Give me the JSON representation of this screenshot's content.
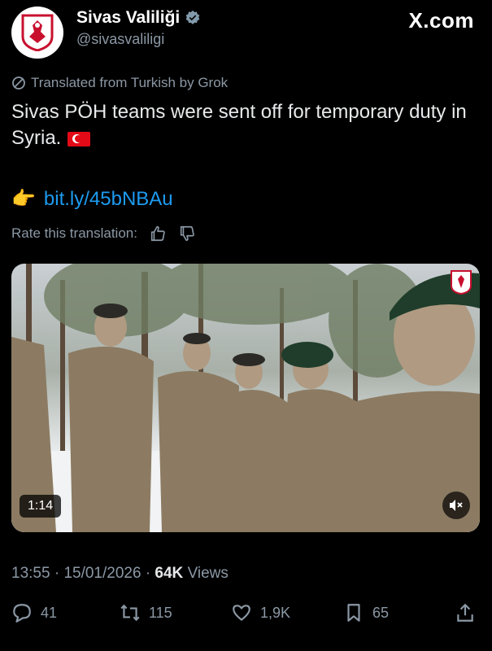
{
  "account": {
    "display_name": "Sivas Valiliği",
    "handle": "@sivasvaliligi",
    "verified_icon": "verified-badge-icon",
    "avatar_icon": "sivas-seal-logo"
  },
  "site": {
    "label": "X.com"
  },
  "translation": {
    "label": "Translated from Turkish by Grok",
    "rate_label": "Rate this translation:"
  },
  "tweet": {
    "text": "Sivas PÖH teams were sent off for temporary duty in Syria.",
    "emoji": "turkish-flag-icon",
    "link_emoji": "👉",
    "link": "bit.ly/45bNBAu"
  },
  "media": {
    "duration": "1:14",
    "mute_icon": "speaker-muted-icon"
  },
  "meta": {
    "time": "13:55",
    "date": "15/01/2026",
    "separator": "·",
    "views_count": "64K",
    "views_label": "Views"
  },
  "actions": {
    "replies": "41",
    "reposts": "115",
    "likes": "1,9K",
    "bookmarks": "65"
  },
  "colors": {
    "background": "#000000",
    "text": "#e7e9ea",
    "secondary": "#8b98a5",
    "link": "#1d9bf0",
    "verified": "#829aab",
    "flag_red": "#e30a17"
  }
}
